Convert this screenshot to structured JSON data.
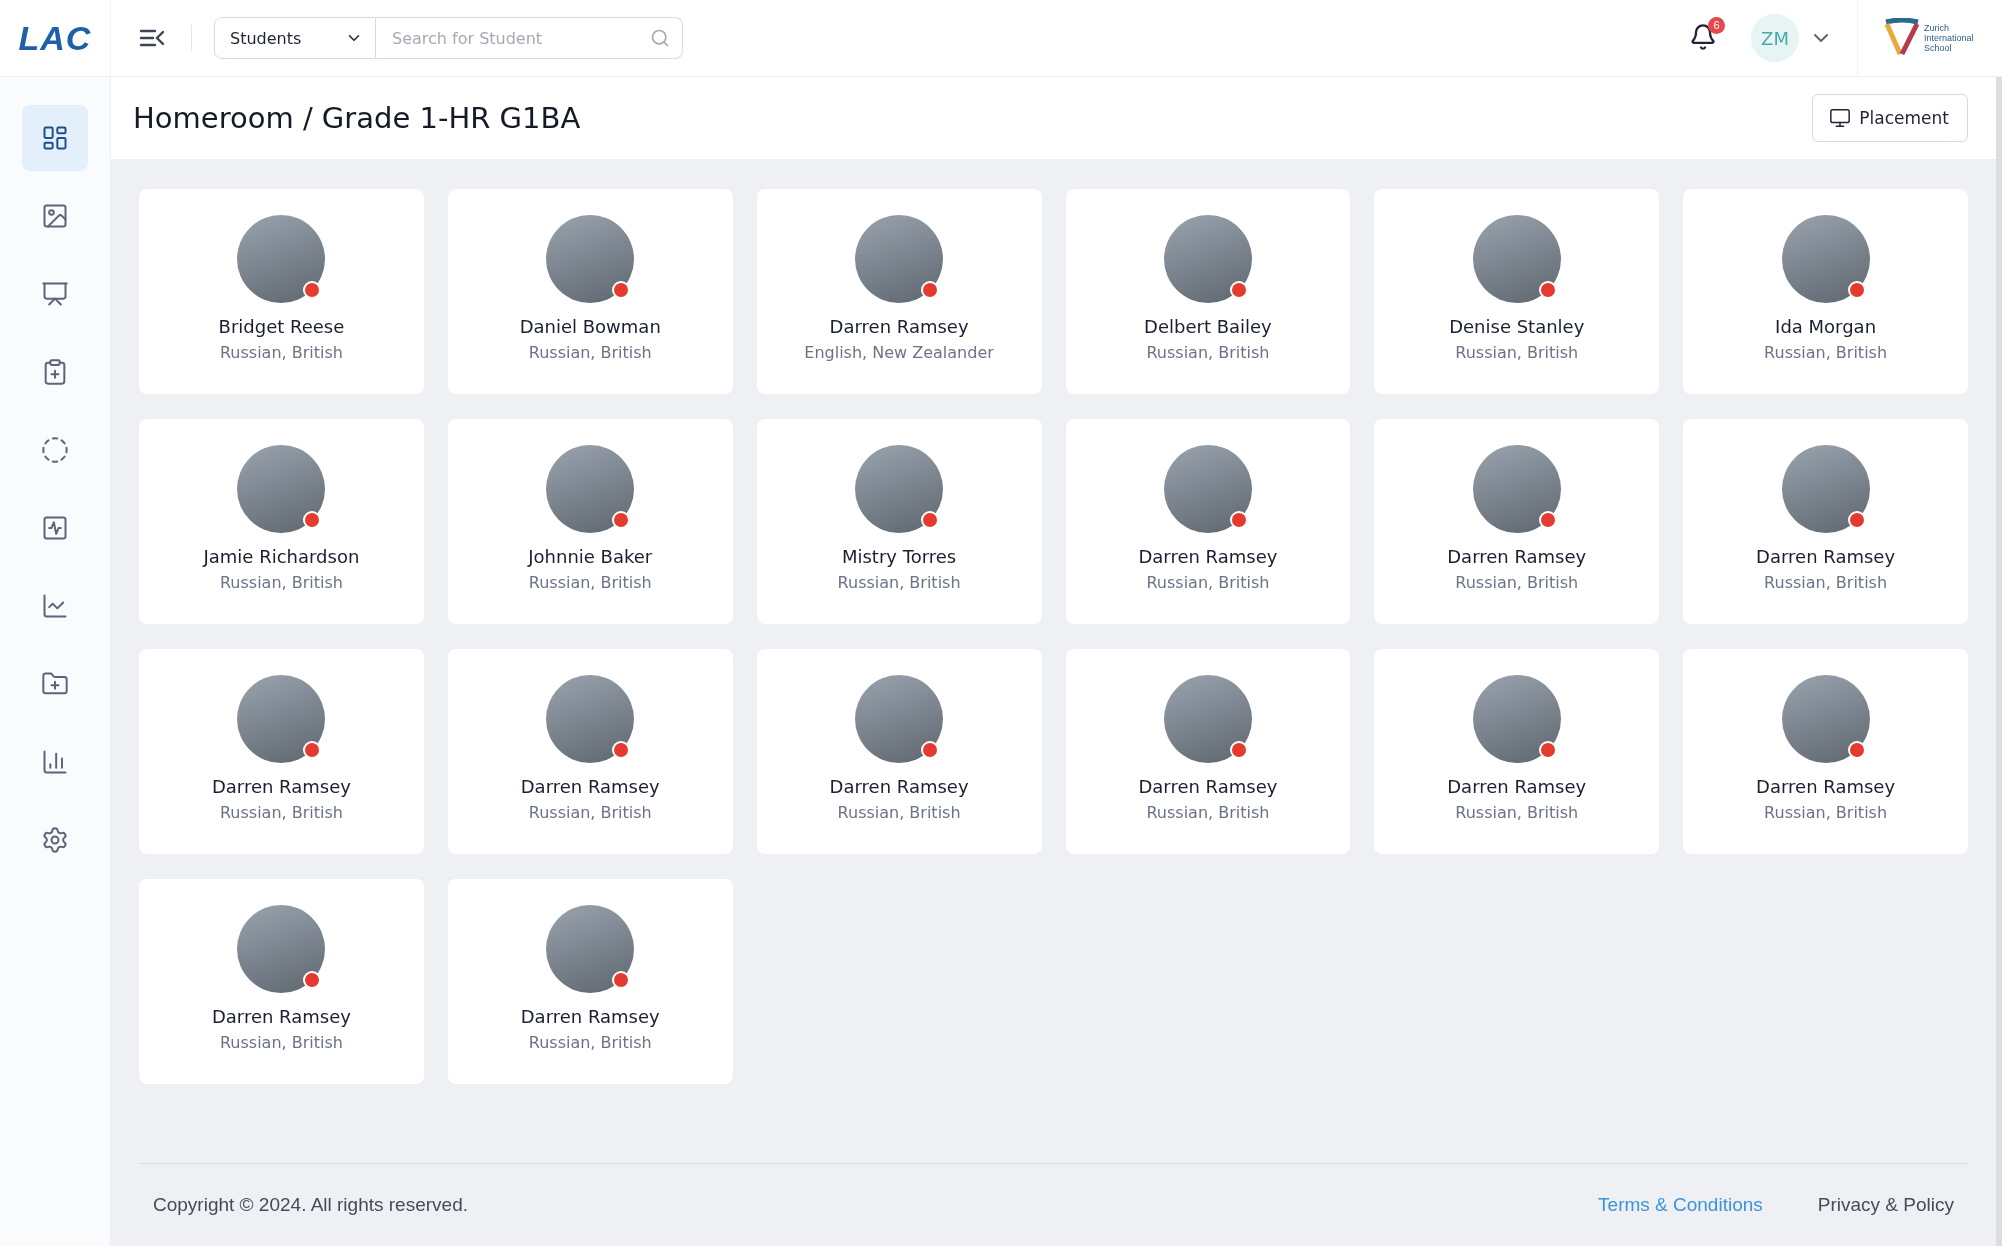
{
  "logo": {
    "text": "LAC"
  },
  "search": {
    "category": "Students",
    "placeholder": "Search for Student"
  },
  "notifications": {
    "count": "6"
  },
  "user": {
    "initials": "ZM"
  },
  "school": {
    "name": "Zurich International School"
  },
  "sidebar": {
    "items": [
      {
        "kind": "dashboard",
        "selected": true
      },
      {
        "kind": "gallery",
        "selected": false
      },
      {
        "kind": "presentation",
        "selected": false
      },
      {
        "kind": "clipboard",
        "selected": false
      },
      {
        "kind": "progress",
        "selected": false
      },
      {
        "kind": "activity",
        "selected": false
      },
      {
        "kind": "linechart",
        "selected": false
      },
      {
        "kind": "folder",
        "selected": false
      },
      {
        "kind": "barchart",
        "selected": false
      },
      {
        "kind": "settings",
        "selected": false
      }
    ]
  },
  "page": {
    "title": "Homeroom / Grade 1-HR G1BA",
    "action": "Placement"
  },
  "students": [
    {
      "name": "Bridget Reese",
      "nationality": "Russian, British"
    },
    {
      "name": "Daniel Bowman",
      "nationality": "Russian, British"
    },
    {
      "name": "Darren Ramsey",
      "nationality": "English, New Zealander"
    },
    {
      "name": "Delbert Bailey",
      "nationality": "Russian, British"
    },
    {
      "name": "Denise Stanley",
      "nationality": "Russian, British"
    },
    {
      "name": "Ida Morgan",
      "nationality": "Russian, British"
    },
    {
      "name": "Jamie Richardson",
      "nationality": "Russian, British"
    },
    {
      "name": "Johnnie Baker",
      "nationality": "Russian, British"
    },
    {
      "name": "Mistry Torres",
      "nationality": "Russian, British"
    },
    {
      "name": "Darren Ramsey",
      "nationality": "Russian, British"
    },
    {
      "name": "Darren Ramsey",
      "nationality": "Russian, British"
    },
    {
      "name": "Darren Ramsey",
      "nationality": "Russian, British"
    },
    {
      "name": "Darren Ramsey",
      "nationality": "Russian, British"
    },
    {
      "name": "Darren Ramsey",
      "nationality": "Russian, British"
    },
    {
      "name": "Darren Ramsey",
      "nationality": "Russian, British"
    },
    {
      "name": "Darren Ramsey",
      "nationality": "Russian, British"
    },
    {
      "name": "Darren Ramsey",
      "nationality": "Russian, British"
    },
    {
      "name": "Darren Ramsey",
      "nationality": "Russian, British"
    },
    {
      "name": "Darren Ramsey",
      "nationality": "Russian, British"
    },
    {
      "name": "Darren Ramsey",
      "nationality": "Russian, British"
    }
  ],
  "footer": {
    "copyright": "Copyright © 2024. All rights reserved.",
    "links": [
      "Terms & Conditions",
      "Privacy & Policy"
    ]
  }
}
